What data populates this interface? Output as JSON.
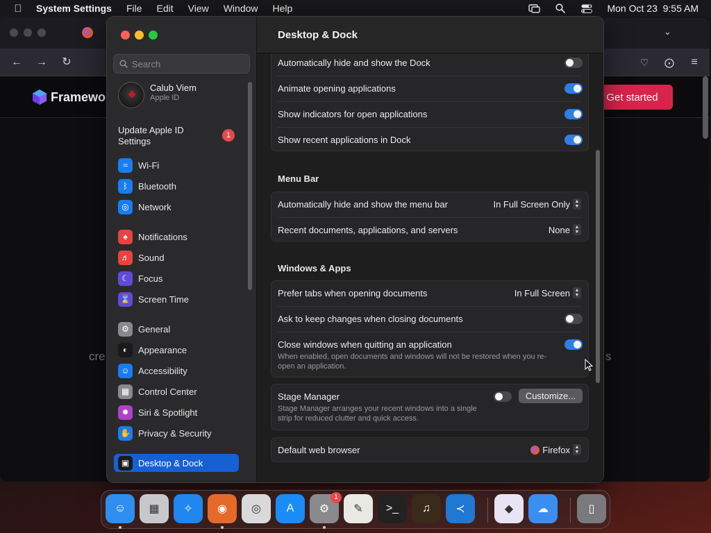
{
  "menubar": {
    "app_name": "System Settings",
    "menus": [
      "File",
      "Edit",
      "View",
      "Window",
      "Help"
    ],
    "datetime": "Mon Oct 23  9:55 AM"
  },
  "browser": {
    "brand": "Framewo",
    "cta": "Get started",
    "bg_left": "cre",
    "bg_right": "s"
  },
  "sidebar": {
    "search_placeholder": "Search",
    "profile": {
      "name": "Calub Viem",
      "sub": "Apple ID"
    },
    "update": {
      "label": "Update Apple ID Settings",
      "badge": "1"
    },
    "items": [
      {
        "label": "Wi-Fi",
        "icon": "wifi-icon",
        "color": "#1a7cf0"
      },
      {
        "label": "Bluetooth",
        "icon": "bluetooth-icon",
        "color": "#1a7cf0"
      },
      {
        "label": "Network",
        "icon": "network-icon",
        "color": "#1a7cf0"
      },
      {
        "label": "Notifications",
        "icon": "bell-icon",
        "color": "#e8433f"
      },
      {
        "label": "Sound",
        "icon": "speaker-icon",
        "color": "#e8433f"
      },
      {
        "label": "Focus",
        "icon": "moon-icon",
        "color": "#5f4bd8"
      },
      {
        "label": "Screen Time",
        "icon": "hourglass-icon",
        "color": "#5f4bd8"
      },
      {
        "label": "General",
        "icon": "gear-icon",
        "color": "#8a8a8e"
      },
      {
        "label": "Appearance",
        "icon": "appearance-icon",
        "color": "#1a1a1a"
      },
      {
        "label": "Accessibility",
        "icon": "accessibility-icon",
        "color": "#1a7cf0"
      },
      {
        "label": "Control Center",
        "icon": "control-center-icon",
        "color": "#8a8a8e"
      },
      {
        "label": "Siri & Spotlight",
        "icon": "siri-icon",
        "color": "#b040c8"
      },
      {
        "label": "Privacy & Security",
        "icon": "hand-icon",
        "color": "#1a7cf0"
      },
      {
        "label": "Desktop & Dock",
        "icon": "dock-icon",
        "color": "#1a1a1a"
      }
    ]
  },
  "main": {
    "title": "Desktop & Dock",
    "dock_rows": [
      {
        "label": "Automatically hide and show the Dock",
        "on": false
      },
      {
        "label": "Animate opening applications",
        "on": true
      },
      {
        "label": "Show indicators for open applications",
        "on": true
      },
      {
        "label": "Show recent applications in Dock",
        "on": true
      }
    ],
    "menu_bar": {
      "title": "Menu Bar",
      "rows": [
        {
          "label": "Automatically hide and show the menu bar",
          "value": "In Full Screen Only"
        },
        {
          "label": "Recent documents, applications, and servers",
          "value": "None"
        }
      ]
    },
    "windows_apps": {
      "title": "Windows & Apps",
      "prefer_tabs": {
        "label": "Prefer tabs when opening documents",
        "value": "In Full Screen"
      },
      "ask_keep": {
        "label": "Ask to keep changes when closing documents",
        "on": false
      },
      "close_windows": {
        "label": "Close windows when quitting an application",
        "desc": "When enabled, open documents and windows will not be restored when you re-open an application.",
        "on": true
      }
    },
    "stage_manager": {
      "label": "Stage Manager",
      "desc": "Stage Manager arranges your recent windows into a single strip for reduced clutter and quick access.",
      "on": false,
      "button": "Customize..."
    },
    "default_browser": {
      "label": "Default web browser",
      "value": "Firefox"
    }
  },
  "dock": {
    "apps": [
      {
        "name": "finder",
        "color": "#2f8ef0",
        "glyph": "☺",
        "running": true
      },
      {
        "name": "launchpad",
        "color": "#c8c8cc",
        "glyph": "▦",
        "running": false
      },
      {
        "name": "safari",
        "color": "#1f86f0",
        "glyph": "✧",
        "running": false
      },
      {
        "name": "firefox",
        "color": "#e56a2a",
        "glyph": "◉",
        "running": true
      },
      {
        "name": "chrome",
        "color": "#d9d9d9",
        "glyph": "◎",
        "running": false
      },
      {
        "name": "app-store",
        "color": "#1a8cf5",
        "glyph": "A",
        "running": false
      },
      {
        "name": "system-settings",
        "color": "#8a8a8e",
        "glyph": "⚙",
        "running": true,
        "badge": "1"
      },
      {
        "name": "textedit",
        "color": "#e9e9e4",
        "glyph": "✎",
        "running": false
      },
      {
        "name": "terminal",
        "color": "#222",
        "glyph": ">_",
        "running": false
      },
      {
        "name": "garageband",
        "color": "#3a2a1a",
        "glyph": "♫",
        "running": false
      },
      {
        "name": "vscode",
        "color": "#1f78d1",
        "glyph": "≺",
        "running": false
      },
      {
        "name": "visual-studio",
        "color": "#e8e4f4",
        "glyph": "◆",
        "running": false
      },
      {
        "name": "weather",
        "color": "#3a8ef0",
        "glyph": "☁",
        "running": false
      },
      {
        "name": "trash",
        "color": "#7a7a7e",
        "glyph": "▯",
        "running": false
      }
    ]
  }
}
